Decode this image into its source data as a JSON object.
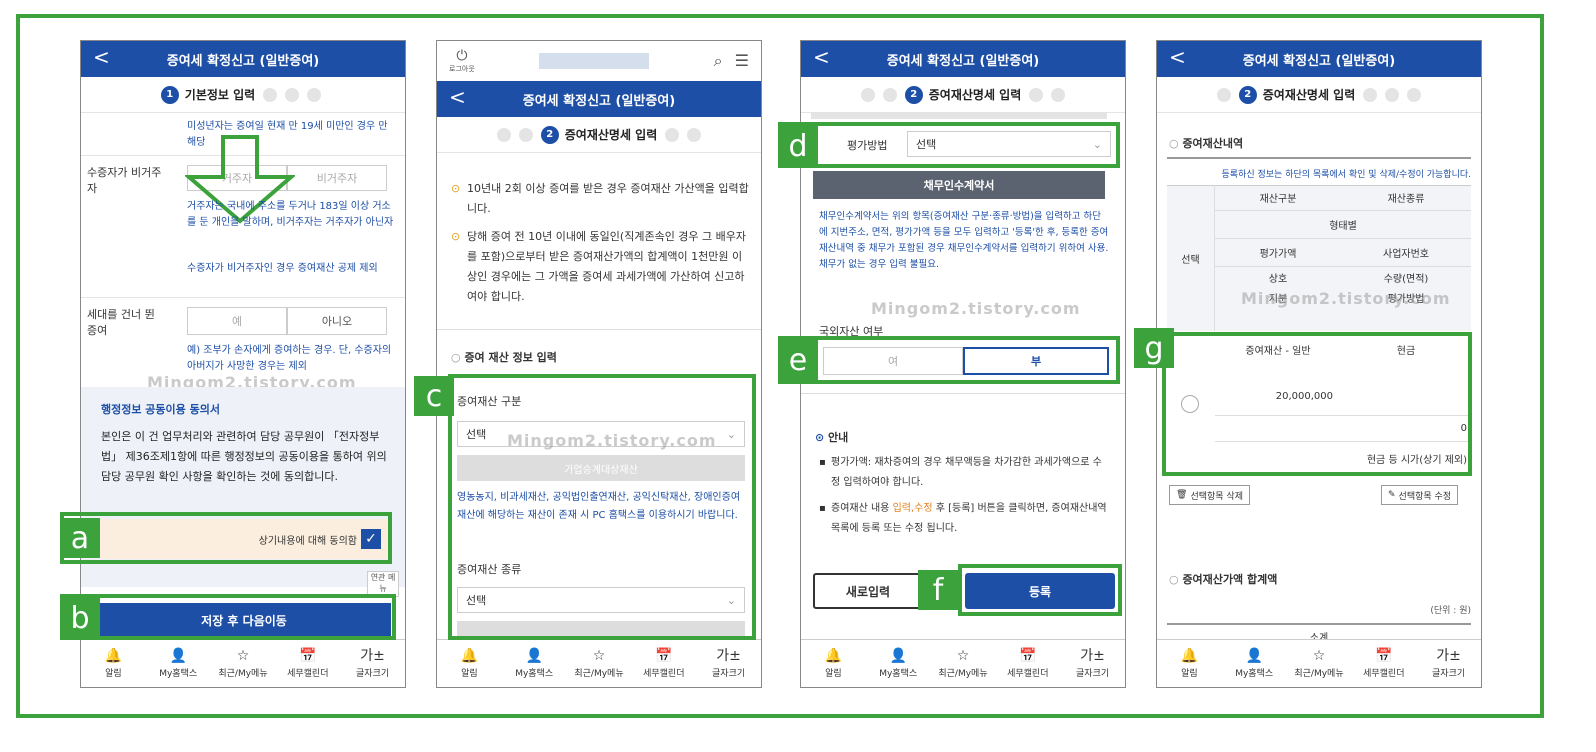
{
  "common": {
    "title": "증여세 확정신고 (일반증여)",
    "back_glyph": "<",
    "nav": [
      {
        "icon": "🔔",
        "label": "알림"
      },
      {
        "icon": "👤",
        "label": "My홈택스"
      },
      {
        "icon": "☆",
        "label": "최근/My메뉴"
      },
      {
        "icon": "📅",
        "label": "세무캘린더"
      },
      {
        "icon": "가±",
        "label": "글자크기"
      }
    ]
  },
  "labels": [
    "a",
    "b",
    "c",
    "d",
    "e",
    "f",
    "g"
  ],
  "watermark": "Mingom2.tistory.com",
  "screen1": {
    "step_num": "1",
    "step_label": "기본정보 입력",
    "note_top": "미성년자는 증여일 현재 만 19세 미만인 경우 만 해당",
    "nonres_label": "수증자가 비거주자",
    "opt_res": "거주자",
    "opt_nonres": "비거주자",
    "note_res": "거주자는 국내에 주소를 두거나 183일 이상 거소를 둔 개인을 말하며, 비거주자는 거주자가 아닌자",
    "note_res2": "수증자가 비거주자인 경우 증여재산 공제 제외",
    "gen_label": "세대를 건너 뛴 증여",
    "opt_yes": "예",
    "opt_no": "아니오",
    "note_gen": "예) 조부가 손자에게 증여하는 경우. 단, 수증자의 아버지가 사망한 경우는 제외",
    "consent_title": "행정정보 공동이용 동의서",
    "consent_body": "본인은 이 건 업무처리와 관련하여 담당 공무원이 「전자정부법」 제36조제1항에 따른 행정정보의 공동이용을 통하여 위의 담당 공무원 확인 사항을 확인하는 것에 동의합니다.",
    "agree_label": "상기내용에 대해 동의함",
    "related_label": "연관 메뉴",
    "save_next": "저장 후 다음이동"
  },
  "screen2": {
    "logout": "로그아웃",
    "step_num": "2",
    "step_label": "증여재산명세 입력",
    "bullet1": "10년내 2회 이상 증여를 받은 경우 증여재산 가산액을 입력합니다.",
    "bullet2": "당해 증여 전 10년 이내에 동일인(직계존속인 경우 그 배우자를 포함)으로부터 받은 증여재산가액의 합계액이 1천만원 이상인 경우에는 그 가액을 증여세 과세가액에 가산하여 신고하여야 합니다.",
    "section": "증여 재산 정보 입력",
    "cat_label": "증여재산 구분",
    "select": "선택",
    "gray_btn": "가업승계대상재산",
    "note": "영농농지, 비과세재산, 공익법인출연재산, 공익신탁재산, 장애인증여재산에 해당하는 재산이 존재 시 PC 홈택스를 이용하시기 바랍니다.",
    "kind_label": "증여재산 종류"
  },
  "screen3": {
    "step_num": "2",
    "step_label": "증여재산명세 입력",
    "eval_label": "평가방법",
    "select": "선택",
    "debt_btn": "채무인수계약서",
    "note": "채무인수계약서는 위의 항목(증여재산 구분·종류·방법)을 입력하고 하단에 지번주소, 면적, 평가가액 등을 모두 입력하고 '등록'한 후, 등록한 증여재산내역 중 채무가 포함된 경우 채무인수계약서를 입력하기 위하여 사용. 채무가 없는 경우 입력 불필요.",
    "foreign_label": "국외자산 여부",
    "opt_yes": "여",
    "opt_no": "부",
    "info_title": "안내",
    "info1": "평가가액: 재차증여의 경우 채무액등을 차가감한 과세가액으로 수정 입력하여야 합니다.",
    "info2_pre": "증여재산 내용 ",
    "info2_hl": "입력,수정",
    "info2_post": " 후 [등록] 버튼을 클릭하면, 증여재산내역 목록에 등록 또는 수정 됩니다.",
    "new_btn": "새로입력",
    "reg_btn": "등록"
  },
  "screen4": {
    "step_num": "2",
    "step_label": "증여재산명세 입력",
    "section": "증여재산내역",
    "desc": "등록하신 정보는 하단의 목록에서 확인 및 삭제/수정이 가능합니다.",
    "col_select": "선택",
    "h": [
      "재산구분",
      "재산종류",
      "형태별",
      "평가가액",
      "사업자번호",
      "상호",
      "수량(면적)",
      "지분",
      "평가방법"
    ],
    "row": {
      "cat": "증여재산 - 일반",
      "kind": "현금",
      "value": "20,000,000",
      "zero": "0",
      "method": "현금 등 시가(상기 제외)"
    },
    "del_btn": "선택항목 삭제",
    "edit_btn": "선택항목 수정",
    "total_title": "증여재산가액 합계액",
    "unit": "(단위 : 원)",
    "sum": "소계"
  }
}
